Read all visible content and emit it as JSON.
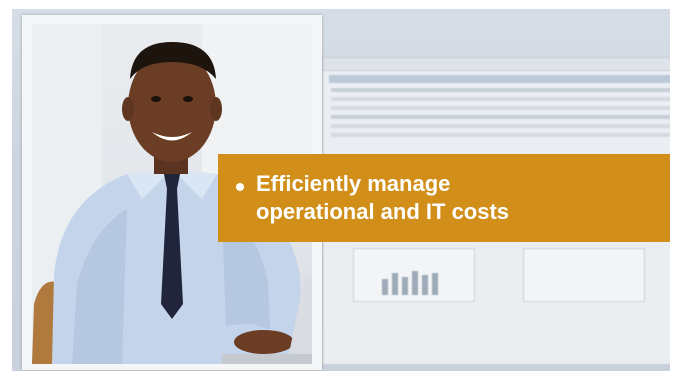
{
  "callout": {
    "line1": "Efficiently manage",
    "line2": "operational and IT costs",
    "color": "#d18f1a"
  },
  "colors": {
    "background": "#cdd6e0",
    "photo_frame": "#f5f6f7"
  }
}
